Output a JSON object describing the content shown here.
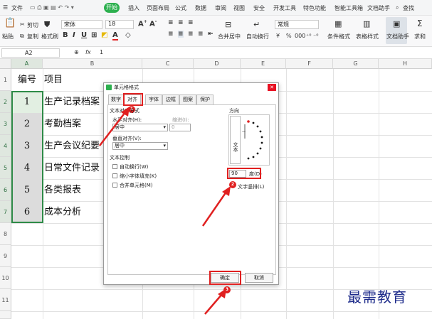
{
  "menubar": {
    "file": "文件",
    "items": [
      "开始",
      "插入",
      "页面布局",
      "公式",
      "数据",
      "审阅",
      "视图",
      "安全",
      "开发工具",
      "特色功能",
      "智能工具箱",
      "文档助手"
    ],
    "search": "查找"
  },
  "ribbon": {
    "paste": "粘贴",
    "cut": "剪切",
    "copy": "复制",
    "format_painter": "格式刷",
    "font_name": "宋体",
    "font_size": "18",
    "merge_center": "合并居中",
    "wrap_text": "自动换行",
    "number_format": "常规",
    "conditional_format": "条件格式",
    "table_style": "表格样式",
    "doc_assistant": "文档助手",
    "sum": "求和",
    "percent": "%",
    "thousands": "000"
  },
  "formulabar": {
    "name_box": "A2",
    "fx": "fx",
    "formula": "1"
  },
  "grid": {
    "columns": [
      "A",
      "B",
      "C",
      "D",
      "E",
      "F",
      "G",
      "H"
    ],
    "rows": [
      "1",
      "2",
      "3",
      "4",
      "5",
      "6",
      "7",
      "8",
      "9",
      "10",
      "11"
    ],
    "header_A": "编号",
    "header_B": "项目",
    "data": [
      {
        "num": "1",
        "item": "生产记录档案"
      },
      {
        "num": "2",
        "item": "考勤档案"
      },
      {
        "num": "3",
        "item": "生产会议纪要"
      },
      {
        "num": "4",
        "item": "日常文件记录"
      },
      {
        "num": "5",
        "item": "各类报表"
      },
      {
        "num": "6",
        "item": "成本分析"
      }
    ]
  },
  "dialog": {
    "title": "单元格格式",
    "tabs": [
      "数字",
      "对齐",
      "字体",
      "边框",
      "图案",
      "保护"
    ],
    "active_tab": "对齐",
    "text_align_section": "文本对齐方式",
    "horizontal_label": "水平对齐(H):",
    "horizontal_value": "居中",
    "indent_label": "缩进(I):",
    "indent_value": "0",
    "vertical_label": "垂直对齐(V):",
    "vertical_value": "居中",
    "text_control_section": "文本控制",
    "wrap_label": "自动换行(W)",
    "shrink_label": "缩小字体填充(K)",
    "merge_label": "合并单元格(M)",
    "orientation_section": "方向",
    "orientation_text": "文本",
    "degree_value": "90",
    "degree_label": "度(D)",
    "vertical_text_label": "文字竖排(L)",
    "ok": "确定",
    "cancel": "取消"
  },
  "annotations": {
    "badge1": "1",
    "badge2": "2",
    "badge3": "3",
    "accent": "#e02020"
  },
  "watermark": "最需教育"
}
